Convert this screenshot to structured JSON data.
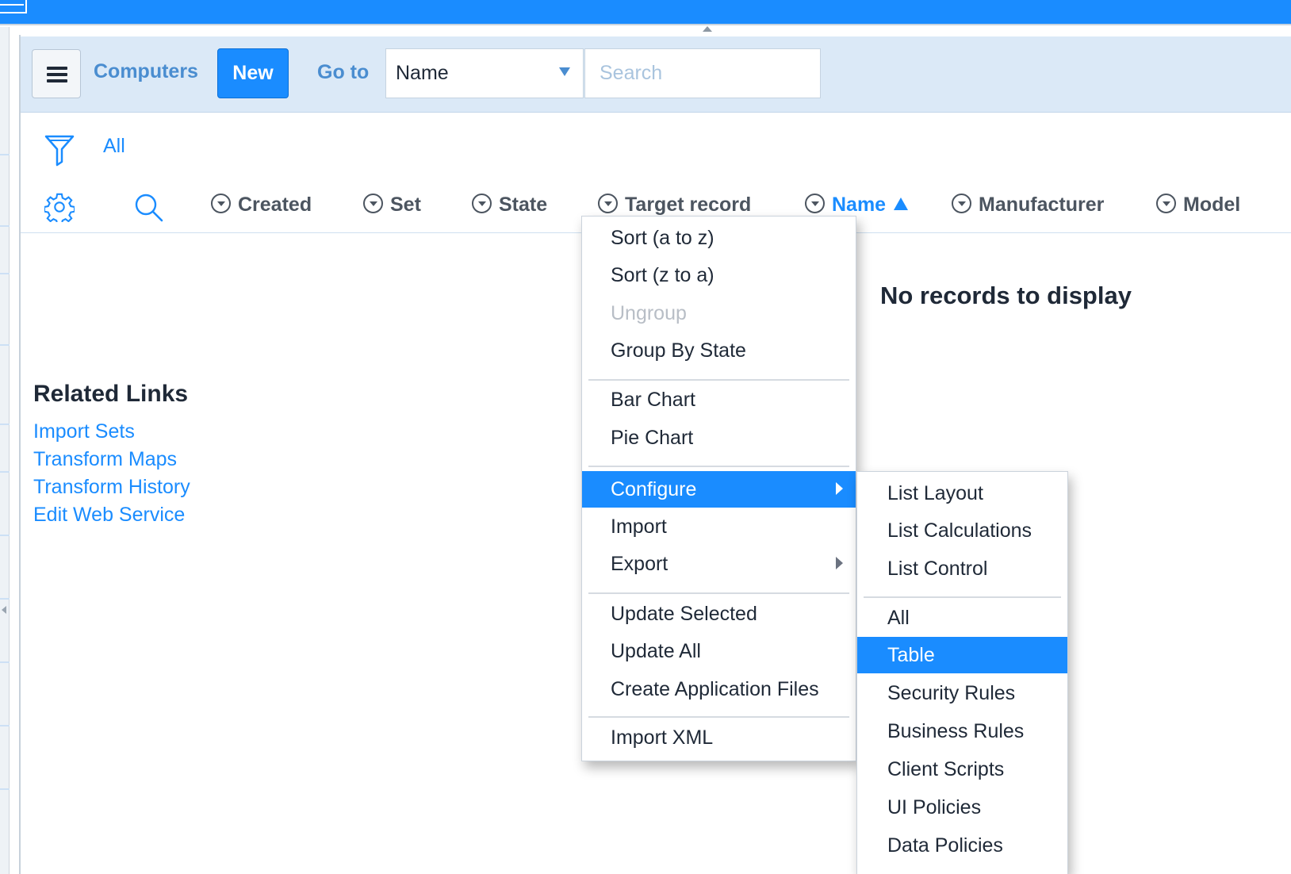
{
  "header": {
    "title": "Computers",
    "new_label": "New",
    "goto_label": "Go to",
    "select_value": "Name",
    "search_placeholder": "Search"
  },
  "filter": {
    "label": "All"
  },
  "columns": [
    {
      "label": "Created"
    },
    {
      "label": "Set"
    },
    {
      "label": "State"
    },
    {
      "label": "Target record"
    },
    {
      "label": "Name"
    },
    {
      "label": "Manufacturer"
    },
    {
      "label": "Model"
    }
  ],
  "empty_message": "No records to display",
  "related": {
    "title": "Related Links",
    "links": [
      "Import Sets",
      "Transform Maps",
      "Transform History",
      "Edit Web Service"
    ]
  },
  "context_menu": {
    "items": [
      "Sort (a to z)",
      "Sort (z to a)",
      "Ungroup",
      "Group By State",
      "Bar Chart",
      "Pie Chart",
      "Configure",
      "Import",
      "Export",
      "Update Selected",
      "Update All",
      "Create Application Files",
      "Import XML"
    ]
  },
  "submenu": {
    "items": [
      "List Layout",
      "List Calculations",
      "List Control",
      "All",
      "Table",
      "Security Rules",
      "Business Rules",
      "Client Scripts",
      "UI Policies",
      "Data Policies"
    ]
  },
  "colors": {
    "accent": "#1a8cff",
    "header_bg": "#dbe9f7",
    "link": "#1a8cff"
  }
}
